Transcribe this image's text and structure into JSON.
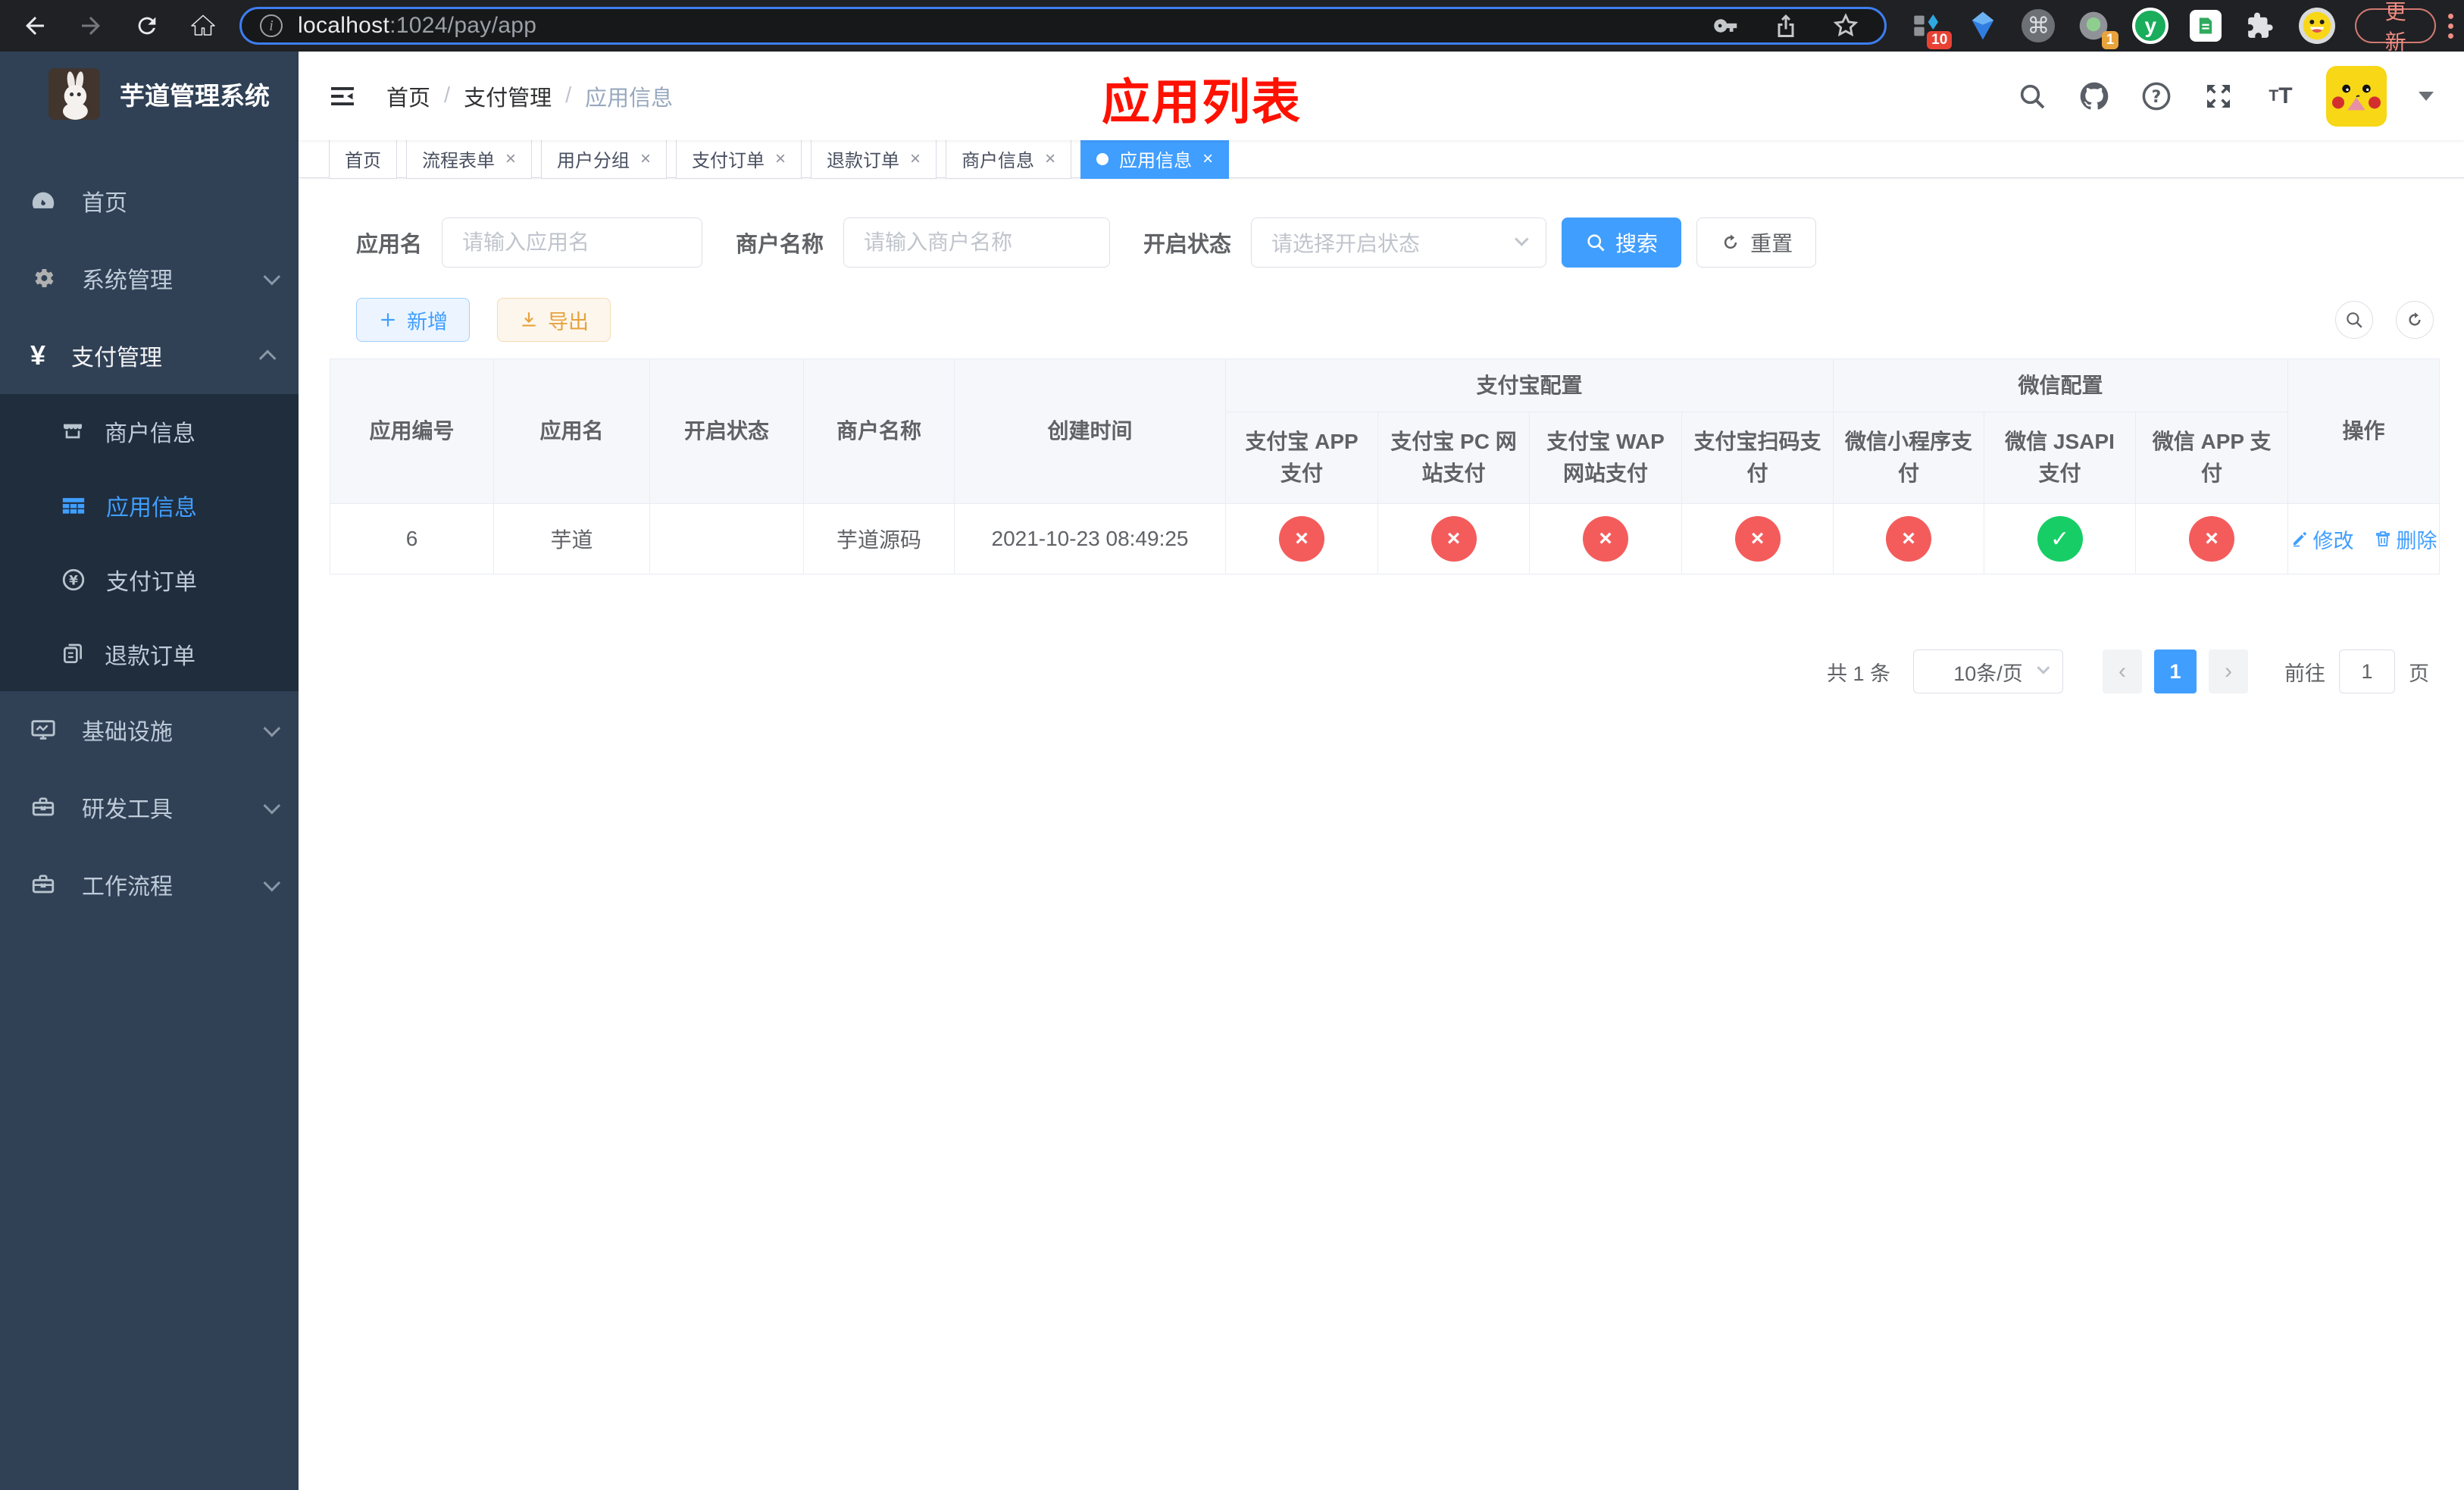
{
  "browser": {
    "url": {
      "host": "localhost",
      "path": ":1024/pay/app"
    },
    "extensions": {
      "badge1": "10",
      "badge2": "1",
      "letter": "y"
    },
    "update_button": "更新"
  },
  "sidebar": {
    "title": "芋道管理系统",
    "menu": [
      {
        "label": "首页"
      },
      {
        "label": "系统管理"
      },
      {
        "label": "支付管理"
      },
      {
        "label": "商户信息"
      },
      {
        "label": "应用信息"
      },
      {
        "label": "支付订单"
      },
      {
        "label": "退款订单"
      },
      {
        "label": "基础设施"
      },
      {
        "label": "研发工具"
      },
      {
        "label": "工作流程"
      }
    ]
  },
  "navbar": {
    "breadcrumb": [
      "首页",
      "支付管理",
      "应用信息"
    ]
  },
  "annotation": "应用列表",
  "tabs": [
    {
      "label": "首页"
    },
    {
      "label": "流程表单"
    },
    {
      "label": "用户分组"
    },
    {
      "label": "支付订单"
    },
    {
      "label": "退款订单"
    },
    {
      "label": "商户信息"
    },
    {
      "label": "应用信息"
    }
  ],
  "filters": {
    "app_name_label": "应用名",
    "app_name_placeholder": "请输入应用名",
    "merchant_label": "商户名称",
    "merchant_placeholder": "请输入商户名称",
    "status_label": "开启状态",
    "status_placeholder": "请选择开启状态",
    "search": "搜索",
    "reset": "重置"
  },
  "toolbar": {
    "add": "新增",
    "export": "导出"
  },
  "table": {
    "headers": {
      "app_id": "应用编号",
      "app_name": "应用名",
      "status": "开启状态",
      "merchant": "商户名称",
      "created": "创建时间",
      "alipay_group": "支付宝配置",
      "wechat_group": "微信配置",
      "alipay_app": "支付宝 APP 支付",
      "alipay_pc": "支付宝 PC 网站支付",
      "alipay_wap": "支付宝 WAP 网站支付",
      "alipay_scan": "支付宝扫码支付",
      "wx_mini": "微信小程序支付",
      "wx_jsapi": "微信 JSAPI 支付",
      "wx_app": "微信 APP 支付",
      "actions": "操作"
    },
    "row": {
      "app_id": "6",
      "app_name": "芋道",
      "enabled": true,
      "merchant": "芋道源码",
      "created": "2021-10-23 08:49:25",
      "statuses": [
        "no",
        "no",
        "no",
        "no",
        "no",
        "yes",
        "no"
      ],
      "edit": "修改",
      "delete": "删除"
    }
  },
  "pagination": {
    "total": "共 1 条",
    "page_size": "10条/页",
    "page": "1",
    "goto": "前往",
    "goto_value": "1",
    "unit": "页"
  },
  "colors": {
    "accent": "#409eff",
    "danger": "#f45c5c",
    "success": "#17ce66",
    "warning": "#e6a23c",
    "sidebar": "#304156"
  }
}
